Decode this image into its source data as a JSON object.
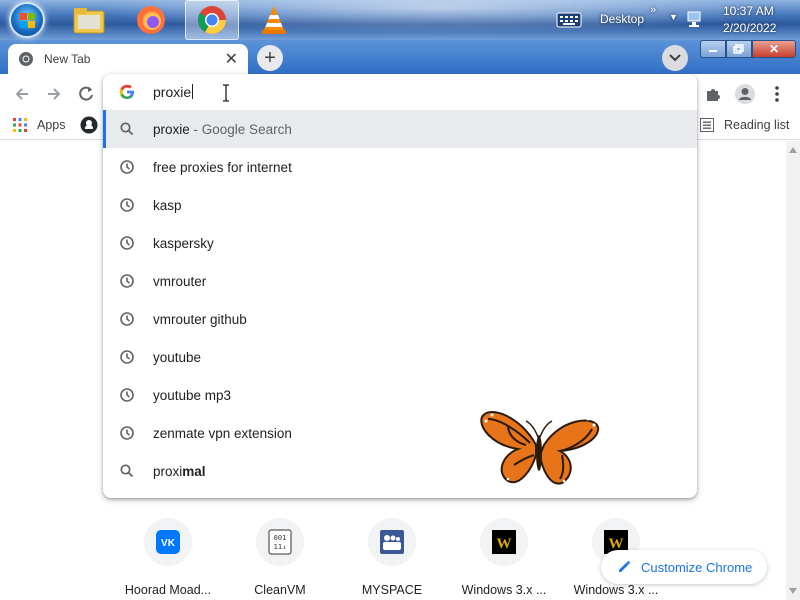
{
  "taskbar": {
    "apps": [
      "windows-start",
      "file-explorer",
      "firefox",
      "chrome",
      "vlc"
    ],
    "desktop_label": "Desktop",
    "time": "10:37 AM",
    "date": "2/20/2022"
  },
  "tab": {
    "title": "New Tab"
  },
  "omnibox": {
    "value": "proxie",
    "suggestions": [
      {
        "type": "search",
        "text": "proxie",
        "sub": " - Google Search",
        "selected": true
      },
      {
        "type": "history",
        "text": "free proxies for internet"
      },
      {
        "type": "history",
        "text": "kasp"
      },
      {
        "type": "history",
        "text": "kaspersky"
      },
      {
        "type": "history",
        "text": "vmrouter"
      },
      {
        "type": "history",
        "text": "vmrouter github"
      },
      {
        "type": "history",
        "text": "youtube"
      },
      {
        "type": "history",
        "text": "youtube mp3"
      },
      {
        "type": "history",
        "text": "zenmate vpn extension"
      },
      {
        "type": "search",
        "text_prefix": "proxi",
        "text_bold": "mal"
      }
    ]
  },
  "bookmarks": {
    "apps_label": "Apps",
    "reading_list_label": "Reading list"
  },
  "shortcuts": [
    {
      "label": "Hoorad Moad...",
      "icon": "vk-icon"
    },
    {
      "label": "CleanVM",
      "icon": "binary-icon"
    },
    {
      "label": "MYSPACE",
      "icon": "myspace-icon"
    },
    {
      "label": "Windows 3.x ...",
      "icon": "windows31-icon"
    },
    {
      "label": "Windows 3.x ...",
      "icon": "windows31-icon"
    }
  ],
  "customize_label": "Customize Chrome",
  "colors": {
    "accent": "#1a73e8",
    "selected_row": "#e8eaed",
    "taskbar": "#2e6fc6"
  }
}
